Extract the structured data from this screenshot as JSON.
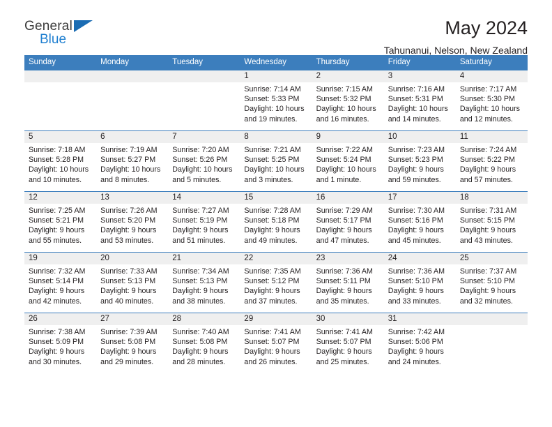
{
  "brand": {
    "name_top": "General",
    "name_bottom": "Blue",
    "accent_color": "#1f7fd0"
  },
  "header": {
    "title": "May 2024",
    "subtitle": "Tahunanui, Nelson, New Zealand",
    "header_bg_color": "#3c7ebd",
    "daynum_bg_color": "#efefef"
  },
  "weekdays": [
    "Sunday",
    "Monday",
    "Tuesday",
    "Wednesday",
    "Thursday",
    "Friday",
    "Saturday"
  ],
  "weeks": [
    {
      "numbers": [
        "",
        "",
        "",
        "1",
        "2",
        "3",
        "4"
      ],
      "days": [
        {
          "num": "",
          "sunrise": "",
          "sunset": "",
          "daylight_1": "",
          "daylight_2": ""
        },
        {
          "num": "",
          "sunrise": "",
          "sunset": "",
          "daylight_1": "",
          "daylight_2": ""
        },
        {
          "num": "",
          "sunrise": "",
          "sunset": "",
          "daylight_1": "",
          "daylight_2": ""
        },
        {
          "num": "1",
          "sunrise": "Sunrise: 7:14 AM",
          "sunset": "Sunset: 5:33 PM",
          "daylight_1": "Daylight: 10 hours",
          "daylight_2": "and 19 minutes."
        },
        {
          "num": "2",
          "sunrise": "Sunrise: 7:15 AM",
          "sunset": "Sunset: 5:32 PM",
          "daylight_1": "Daylight: 10 hours",
          "daylight_2": "and 16 minutes."
        },
        {
          "num": "3",
          "sunrise": "Sunrise: 7:16 AM",
          "sunset": "Sunset: 5:31 PM",
          "daylight_1": "Daylight: 10 hours",
          "daylight_2": "and 14 minutes."
        },
        {
          "num": "4",
          "sunrise": "Sunrise: 7:17 AM",
          "sunset": "Sunset: 5:30 PM",
          "daylight_1": "Daylight: 10 hours",
          "daylight_2": "and 12 minutes."
        }
      ]
    },
    {
      "numbers": [
        "5",
        "6",
        "7",
        "8",
        "9",
        "10",
        "11"
      ],
      "days": [
        {
          "num": "5",
          "sunrise": "Sunrise: 7:18 AM",
          "sunset": "Sunset: 5:28 PM",
          "daylight_1": "Daylight: 10 hours",
          "daylight_2": "and 10 minutes."
        },
        {
          "num": "6",
          "sunrise": "Sunrise: 7:19 AM",
          "sunset": "Sunset: 5:27 PM",
          "daylight_1": "Daylight: 10 hours",
          "daylight_2": "and 8 minutes."
        },
        {
          "num": "7",
          "sunrise": "Sunrise: 7:20 AM",
          "sunset": "Sunset: 5:26 PM",
          "daylight_1": "Daylight: 10 hours",
          "daylight_2": "and 5 minutes."
        },
        {
          "num": "8",
          "sunrise": "Sunrise: 7:21 AM",
          "sunset": "Sunset: 5:25 PM",
          "daylight_1": "Daylight: 10 hours",
          "daylight_2": "and 3 minutes."
        },
        {
          "num": "9",
          "sunrise": "Sunrise: 7:22 AM",
          "sunset": "Sunset: 5:24 PM",
          "daylight_1": "Daylight: 10 hours",
          "daylight_2": "and 1 minute."
        },
        {
          "num": "10",
          "sunrise": "Sunrise: 7:23 AM",
          "sunset": "Sunset: 5:23 PM",
          "daylight_1": "Daylight: 9 hours",
          "daylight_2": "and 59 minutes."
        },
        {
          "num": "11",
          "sunrise": "Sunrise: 7:24 AM",
          "sunset": "Sunset: 5:22 PM",
          "daylight_1": "Daylight: 9 hours",
          "daylight_2": "and 57 minutes."
        }
      ]
    },
    {
      "numbers": [
        "12",
        "13",
        "14",
        "15",
        "16",
        "17",
        "18"
      ],
      "days": [
        {
          "num": "12",
          "sunrise": "Sunrise: 7:25 AM",
          "sunset": "Sunset: 5:21 PM",
          "daylight_1": "Daylight: 9 hours",
          "daylight_2": "and 55 minutes."
        },
        {
          "num": "13",
          "sunrise": "Sunrise: 7:26 AM",
          "sunset": "Sunset: 5:20 PM",
          "daylight_1": "Daylight: 9 hours",
          "daylight_2": "and 53 minutes."
        },
        {
          "num": "14",
          "sunrise": "Sunrise: 7:27 AM",
          "sunset": "Sunset: 5:19 PM",
          "daylight_1": "Daylight: 9 hours",
          "daylight_2": "and 51 minutes."
        },
        {
          "num": "15",
          "sunrise": "Sunrise: 7:28 AM",
          "sunset": "Sunset: 5:18 PM",
          "daylight_1": "Daylight: 9 hours",
          "daylight_2": "and 49 minutes."
        },
        {
          "num": "16",
          "sunrise": "Sunrise: 7:29 AM",
          "sunset": "Sunset: 5:17 PM",
          "daylight_1": "Daylight: 9 hours",
          "daylight_2": "and 47 minutes."
        },
        {
          "num": "17",
          "sunrise": "Sunrise: 7:30 AM",
          "sunset": "Sunset: 5:16 PM",
          "daylight_1": "Daylight: 9 hours",
          "daylight_2": "and 45 minutes."
        },
        {
          "num": "18",
          "sunrise": "Sunrise: 7:31 AM",
          "sunset": "Sunset: 5:15 PM",
          "daylight_1": "Daylight: 9 hours",
          "daylight_2": "and 43 minutes."
        }
      ]
    },
    {
      "numbers": [
        "19",
        "20",
        "21",
        "22",
        "23",
        "24",
        "25"
      ],
      "days": [
        {
          "num": "19",
          "sunrise": "Sunrise: 7:32 AM",
          "sunset": "Sunset: 5:14 PM",
          "daylight_1": "Daylight: 9 hours",
          "daylight_2": "and 42 minutes."
        },
        {
          "num": "20",
          "sunrise": "Sunrise: 7:33 AM",
          "sunset": "Sunset: 5:13 PM",
          "daylight_1": "Daylight: 9 hours",
          "daylight_2": "and 40 minutes."
        },
        {
          "num": "21",
          "sunrise": "Sunrise: 7:34 AM",
          "sunset": "Sunset: 5:13 PM",
          "daylight_1": "Daylight: 9 hours",
          "daylight_2": "and 38 minutes."
        },
        {
          "num": "22",
          "sunrise": "Sunrise: 7:35 AM",
          "sunset": "Sunset: 5:12 PM",
          "daylight_1": "Daylight: 9 hours",
          "daylight_2": "and 37 minutes."
        },
        {
          "num": "23",
          "sunrise": "Sunrise: 7:36 AM",
          "sunset": "Sunset: 5:11 PM",
          "daylight_1": "Daylight: 9 hours",
          "daylight_2": "and 35 minutes."
        },
        {
          "num": "24",
          "sunrise": "Sunrise: 7:36 AM",
          "sunset": "Sunset: 5:10 PM",
          "daylight_1": "Daylight: 9 hours",
          "daylight_2": "and 33 minutes."
        },
        {
          "num": "25",
          "sunrise": "Sunrise: 7:37 AM",
          "sunset": "Sunset: 5:10 PM",
          "daylight_1": "Daylight: 9 hours",
          "daylight_2": "and 32 minutes."
        }
      ]
    },
    {
      "numbers": [
        "26",
        "27",
        "28",
        "29",
        "30",
        "31",
        ""
      ],
      "days": [
        {
          "num": "26",
          "sunrise": "Sunrise: 7:38 AM",
          "sunset": "Sunset: 5:09 PM",
          "daylight_1": "Daylight: 9 hours",
          "daylight_2": "and 30 minutes."
        },
        {
          "num": "27",
          "sunrise": "Sunrise: 7:39 AM",
          "sunset": "Sunset: 5:08 PM",
          "daylight_1": "Daylight: 9 hours",
          "daylight_2": "and 29 minutes."
        },
        {
          "num": "28",
          "sunrise": "Sunrise: 7:40 AM",
          "sunset": "Sunset: 5:08 PM",
          "daylight_1": "Daylight: 9 hours",
          "daylight_2": "and 28 minutes."
        },
        {
          "num": "29",
          "sunrise": "Sunrise: 7:41 AM",
          "sunset": "Sunset: 5:07 PM",
          "daylight_1": "Daylight: 9 hours",
          "daylight_2": "and 26 minutes."
        },
        {
          "num": "30",
          "sunrise": "Sunrise: 7:41 AM",
          "sunset": "Sunset: 5:07 PM",
          "daylight_1": "Daylight: 9 hours",
          "daylight_2": "and 25 minutes."
        },
        {
          "num": "31",
          "sunrise": "Sunrise: 7:42 AM",
          "sunset": "Sunset: 5:06 PM",
          "daylight_1": "Daylight: 9 hours",
          "daylight_2": "and 24 minutes."
        },
        {
          "num": "",
          "sunrise": "",
          "sunset": "",
          "daylight_1": "",
          "daylight_2": ""
        }
      ]
    }
  ]
}
